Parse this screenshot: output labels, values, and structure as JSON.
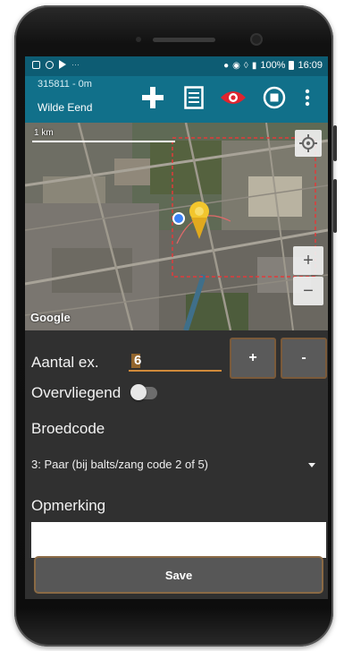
{
  "status_bar": {
    "battery": "100%",
    "time": "16:09"
  },
  "app_bar": {
    "subtitle": "315811 - 0m",
    "title": "Wilde Eend",
    "actions": [
      "add-icon",
      "list-icon",
      "eye-icon",
      "stop-icon",
      "more-vert-icon"
    ],
    "eye_color": "#e0242f"
  },
  "map": {
    "scale_label": "1 km",
    "attribution": "Google",
    "zoom_in": "+",
    "zoom_out": "−"
  },
  "form": {
    "count_label": "Aantal ex.",
    "count_value": "6",
    "plus_label": "+",
    "minus_label": "-",
    "flyover_label": "Overvliegend",
    "flyover_on": false,
    "breeding_label": "Broedcode",
    "breeding_value": "3: Paar (bij balts/zang code 2 of 5)",
    "remark_label": "Opmerking",
    "remark_value": "",
    "save_label": "Save"
  },
  "colors": {
    "header": "#11708a",
    "status": "#0d5c73",
    "accent": "#d08a3a",
    "background": "#303030"
  }
}
